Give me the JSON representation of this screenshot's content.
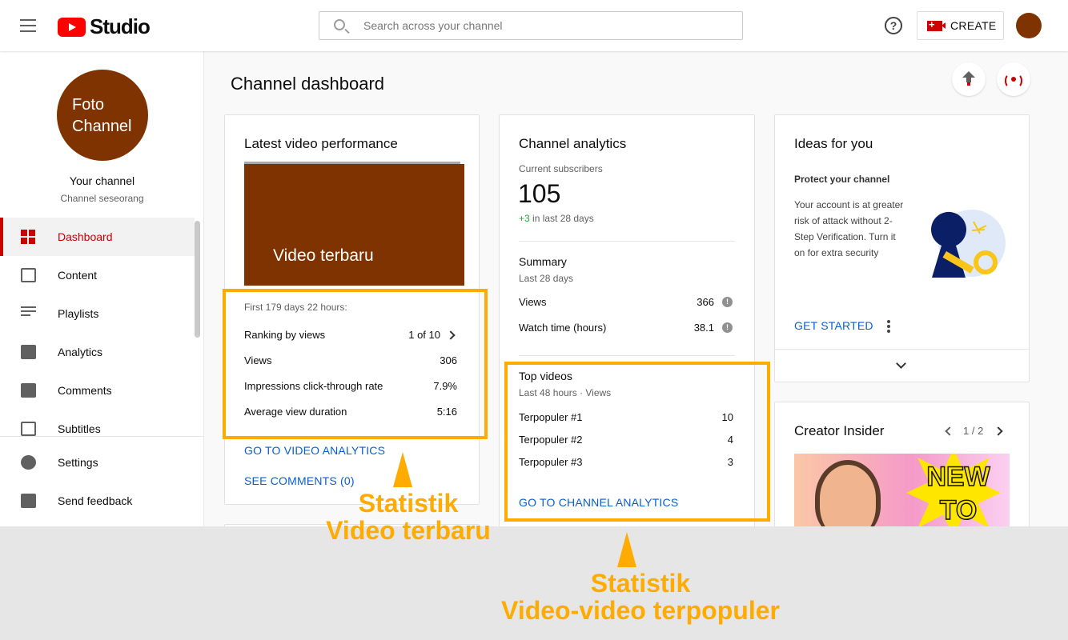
{
  "header": {
    "logo_text": "Studio",
    "search_placeholder": "Search across your channel",
    "help_symbol": "?",
    "create_label": "CREATE"
  },
  "sidebar": {
    "photo_label": "Foto Channel",
    "channel_name": "Your channel",
    "channel_subtitle": "Channel seseorang",
    "items": [
      {
        "label": "Dashboard",
        "icon": "dashboard-icon",
        "active": true
      },
      {
        "label": "Content",
        "icon": "video-library-icon"
      },
      {
        "label": "Playlists",
        "icon": "playlist-icon"
      },
      {
        "label": "Analytics",
        "icon": "bar-chart-icon"
      },
      {
        "label": "Comments",
        "icon": "comment-icon"
      },
      {
        "label": "Subtitles",
        "icon": "subtitles-icon"
      }
    ],
    "footer_items": [
      {
        "label": "Settings",
        "icon": "gear-icon"
      },
      {
        "label": "Send feedback",
        "icon": "feedback-icon"
      }
    ]
  },
  "page": {
    "title": "Channel dashboard"
  },
  "latest_video": {
    "title": "Latest video performance",
    "thumbnail_label": "Video terbaru",
    "period": "First 179 days 22 hours:",
    "stats": [
      {
        "label": "Ranking by views",
        "value": "1 of 10"
      },
      {
        "label": "Views",
        "value": "306"
      },
      {
        "label": "Impressions click-through rate",
        "value": "7.9%"
      },
      {
        "label": "Average view duration",
        "value": "5:16"
      }
    ],
    "link_analytics": "GO TO VIDEO ANALYTICS",
    "link_comments": "SEE COMMENTS (0)"
  },
  "channel_analytics": {
    "title": "Channel analytics",
    "subscribers_label": "Current subscribers",
    "subscribers_value": "105",
    "subscribers_change": "+3",
    "subscribers_change_suffix": " in last 28 days",
    "summary_title": "Summary",
    "summary_period": "Last 28 days",
    "summary_rows": [
      {
        "label": "Views",
        "value": "366"
      },
      {
        "label": "Watch time (hours)",
        "value": "38.1"
      }
    ],
    "info_symbol": "!",
    "top_title": "Top videos",
    "top_period": "Last 48 hours · Views",
    "top_rows": [
      {
        "label": "Terpopuler #1",
        "value": "10"
      },
      {
        "label": "Terpopuler #2",
        "value": "4"
      },
      {
        "label": "Terpopuler #3",
        "value": "3"
      }
    ],
    "link": "GO TO CHANNEL ANALYTICS"
  },
  "ideas": {
    "title": "Ideas for you",
    "heading": "Protect your channel",
    "body": "Your account is at greater risk of attack without 2-Step Verification. Turn it on for extra security",
    "cta": "GET STARTED"
  },
  "creator_insider": {
    "title": "Creator Insider",
    "pager": "1 / 2",
    "image_text": "NEW TO"
  },
  "annotations": {
    "left_line1": "Statistik",
    "left_line2": "Video terbaru",
    "right_line1": "Statistik",
    "right_line2": "Video-video terpopuler"
  },
  "colors": {
    "accent_red": "#cc0000",
    "channel_brown": "#7f3300",
    "link_blue": "#065fd4",
    "annotation_orange": "#ffab00",
    "positive_green": "#2ba640"
  }
}
